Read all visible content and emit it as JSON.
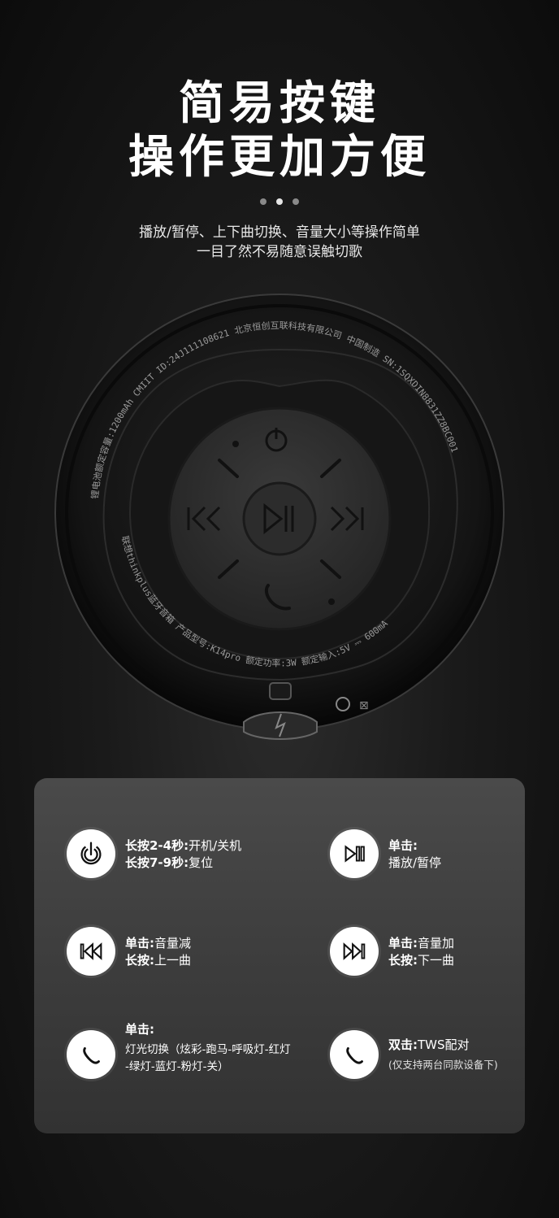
{
  "title": {
    "line1": "简易按键",
    "line2": "操作更加方便"
  },
  "dots": 3,
  "subtitle": {
    "line1": "播放/暂停、上下曲切换、音量大小等操作简单",
    "line2": "一目了然不易随意误触切歌"
  },
  "speaker": {
    "ring_text_top": "锂电池额定容量:1200mAh  CMIIT ID:24J111108621  北京恒创互联科技有限公司  中国制造  SN:1SQXDIN8831ZZ8BC001",
    "ring_text_left": "联想thinkplus蓝牙音箱  产品型号:K14pro  额定功率:3W  额定输入:5V ⎓ 600mA"
  },
  "panel": {
    "items": [
      {
        "icon": "power-icon",
        "l1_bold": "长按2-4秒:",
        "l1": "开机/关机",
        "l2_bold": "长按7-9秒:",
        "l2": "复位"
      },
      {
        "icon": "play-pause-icon",
        "l1_bold": "单击:",
        "l1": "",
        "l2_bold": "",
        "l2": "播放/暂停"
      },
      {
        "icon": "previous-icon",
        "l1_bold": "单击:",
        "l1": "音量减",
        "l2_bold": "长按:",
        "l2": "上一曲"
      },
      {
        "icon": "next-icon",
        "l1_bold": "单击:",
        "l1": "音量加",
        "l2_bold": "长按:",
        "l2": "下一曲"
      },
      {
        "icon": "light-icon",
        "l1_bold": "单击:",
        "l1": "",
        "l2_bold": "",
        "l2": "灯光切换（炫彩-跑马-呼吸灯-红灯",
        "l3": "-绿灯-蓝灯-粉灯-关）"
      },
      {
        "icon": "tws-icon",
        "l1_bold": "双击:",
        "l1": "TWS配对",
        "l2_small": "(仅支持两台同款设备下)"
      }
    ]
  }
}
